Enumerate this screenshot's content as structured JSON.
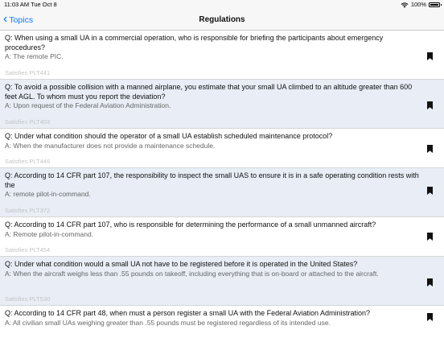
{
  "status_bar": {
    "time_date": "11:03 AM   Tue Oct 8",
    "battery": "100%",
    "battery_level": 1.0
  },
  "nav": {
    "back_label": "Topics",
    "title": "Regulations"
  },
  "questions": [
    {
      "q": "Q: When using a small UA in a commercial operation, who is responsible for briefing the participants about emergency procedures?",
      "a": "A: The remote PIC.",
      "s": "Satisfies PLT441"
    },
    {
      "q": "Q: To avoid a possible collision with a manned airplane, you estimate that your small UA climbed to an altitude greater than 600 feet AGL. To whom must you report the deviation?",
      "a": "A: Upon request of the Federal Aviation Administration.",
      "s": "Satisfies PLT403"
    },
    {
      "q": "Q: Under what condition should the operator of a small UA establish scheduled maintenance protocol?",
      "a": "A: When the manufacturer does not provide a maintenance schedule.",
      "s": "Satisfies PLT446"
    },
    {
      "q": "Q: According to 14 CFR part 107, the responsibility to inspect the small UAS to ensure it is in a safe operating condition rests with the",
      "a": "A: remote pilot-in-command.",
      "s": "Satisfies PLT372"
    },
    {
      "q": "Q: According to 14 CFR part 107, who is responsible for determining the performance of a small unmanned aircraft?",
      "a": "A: Remote pilot-in-command.",
      "s": "Satisfies PLT454"
    },
    {
      "q": "Q: Under what condition would a small UA not have to be registered before it is operated in the United States?",
      "a": "A: When the aircraft weighs less than .55 pounds on takeoff, including everything that is on-board or attached to the aircraft.",
      "s": "Satisfies PLT530"
    },
    {
      "q": "Q: According to 14 CFR part 48, when must a person register a small UA with the Federal Aviation Administration?",
      "a": "A: All civilian small UAs weighing greater than .55 pounds must be registered regardless of its intended use.",
      "s": ""
    }
  ],
  "colors": {
    "accent": "#0a7aff",
    "row_alt": "#e8edf6"
  },
  "icons": {
    "back": "chevron-left-icon",
    "bookmark": "bookmark-icon",
    "wifi": "wifi-icon",
    "battery": "battery-icon"
  }
}
